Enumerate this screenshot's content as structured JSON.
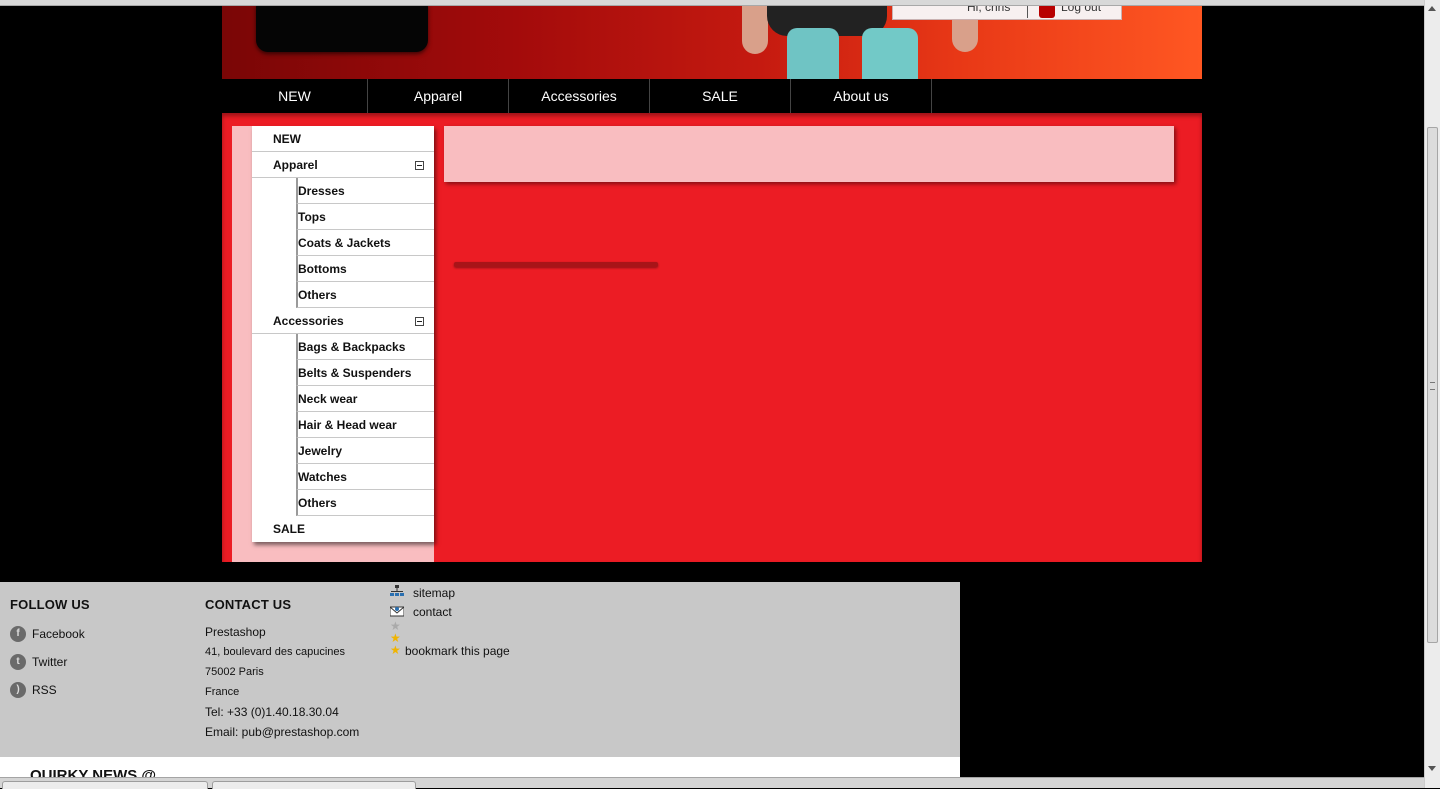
{
  "header": {
    "greeting": "Hi, chris",
    "logout_label": "Log out"
  },
  "nav": {
    "items": [
      {
        "label": "NEW"
      },
      {
        "label": "Apparel"
      },
      {
        "label": "Accessories"
      },
      {
        "label": "SALE"
      },
      {
        "label": "About us"
      }
    ]
  },
  "categories": {
    "new": "NEW",
    "apparel": {
      "label": "Apparel",
      "children": [
        "Dresses",
        "Tops",
        "Coats & Jackets",
        "Bottoms",
        "Others"
      ]
    },
    "accessories": {
      "label": "Accessories",
      "children": [
        "Bags & Backpacks",
        "Belts & Suspenders",
        "Neck wear",
        "Hair & Head wear",
        "Jewelry",
        "Watches",
        "Others"
      ]
    },
    "sale": "SALE"
  },
  "footer": {
    "follow": {
      "title": "FOLLOW US",
      "links": [
        {
          "label": "Facebook",
          "icon": "facebook-icon"
        },
        {
          "label": "Twitter",
          "icon": "twitter-icon"
        },
        {
          "label": "RSS",
          "icon": "rss-icon"
        }
      ]
    },
    "contact": {
      "title": "CONTACT US",
      "company": "Prestashop",
      "address1": "41, boulevard des capucines",
      "address2": "75002 Paris",
      "country": "France",
      "tel": "Tel: +33 (0)1.40.18.30.04",
      "email": "Email: pub@prestashop.com"
    },
    "utility": {
      "sitemap": "sitemap",
      "contact": "contact",
      "bookmark": "bookmark this page"
    },
    "news_title": "QUIRKY NEWS @"
  },
  "colors": {
    "main_red": "#ec1c24",
    "pink": "#f9bdc0",
    "footer_gray": "#c8c8c8"
  }
}
